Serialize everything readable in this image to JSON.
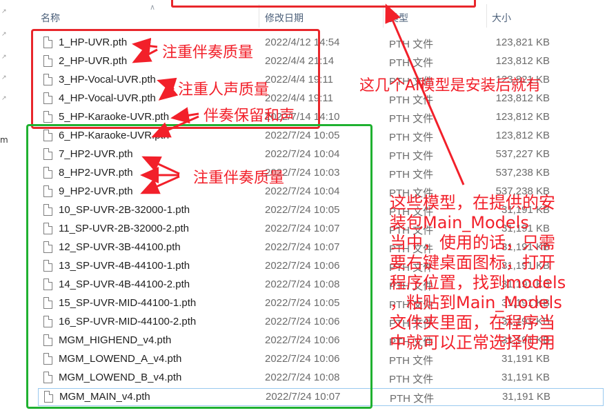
{
  "header": {
    "columns": [
      {
        "label": "名称"
      },
      {
        "label": "修改日期"
      },
      {
        "label": "类型"
      },
      {
        "label": "大小"
      }
    ]
  },
  "nav": {
    "partial_letter": "m"
  },
  "files": [
    {
      "name": "1_HP-UVR.pth",
      "date": "2022/4/12 14:54",
      "type": "PTH 文件",
      "size": "123,821 KB"
    },
    {
      "name": "2_HP-UVR.pth",
      "date": "2022/4/4 21:14",
      "type": "PTH 文件",
      "size": "123,812 KB"
    },
    {
      "name": "3_HP-Vocal-UVR.pth",
      "date": "2022/4/4 19:11",
      "type": "PTH 文件",
      "size": "123,821 KB"
    },
    {
      "name": "4_HP-Vocal-UVR.pth",
      "date": "2022/4/4 19:11",
      "type": "PTH 文件",
      "size": "123,812 KB"
    },
    {
      "name": "5_HP-Karaoke-UVR.pth",
      "date": "2022/7/14 14:10",
      "type": "PTH 文件",
      "size": "123,812 KB"
    },
    {
      "name": "6_HP-Karaoke-UVR.pth",
      "date": "2022/7/24 10:05",
      "type": "PTH 文件",
      "size": "123,812 KB"
    },
    {
      "name": "7_HP2-UVR.pth",
      "date": "2022/7/24 10:04",
      "type": "PTH 文件",
      "size": "537,227 KB"
    },
    {
      "name": "8_HP2-UVR.pth",
      "date": "2022/7/24 10:03",
      "type": "PTH 文件",
      "size": "537,238 KB"
    },
    {
      "name": "9_HP2-UVR.pth",
      "date": "2022/7/24 10:04",
      "type": "PTH 文件",
      "size": "537,238 KB"
    },
    {
      "name": "10_SP-UVR-2B-32000-1.pth",
      "date": "2022/7/24 10:05",
      "type": "PTH 文件",
      "size": "31,191 KB"
    },
    {
      "name": "11_SP-UVR-2B-32000-2.pth",
      "date": "2022/7/24 10:07",
      "type": "PTH 文件",
      "size": "31,191 KB"
    },
    {
      "name": "12_SP-UVR-3B-44100.pth",
      "date": "2022/7/24 10:07",
      "type": "PTH 文件",
      "size": "31,191 KB"
    },
    {
      "name": "13_SP-UVR-4B-44100-1.pth",
      "date": "2022/7/24 10:06",
      "type": "PTH 文件",
      "size": "31,191 KB"
    },
    {
      "name": "14_SP-UVR-4B-44100-2.pth",
      "date": "2022/7/24 10:08",
      "type": "PTH 文件",
      "size": "31,191 KB"
    },
    {
      "name": "15_SP-UVR-MID-44100-1.pth",
      "date": "2022/7/24 10:05",
      "type": "PTH 文件",
      "size": "31,191 KB"
    },
    {
      "name": "16_SP-UVR-MID-44100-2.pth",
      "date": "2022/7/24 10:06",
      "type": "PTH 文件",
      "size": "31,191 KB"
    },
    {
      "name": "MGM_HIGHEND_v4.pth",
      "date": "2022/7/24 10:06",
      "type": "PTH 文件",
      "size": "31,191 KB"
    },
    {
      "name": "MGM_LOWEND_A_v4.pth",
      "date": "2022/7/24 10:06",
      "type": "PTH 文件",
      "size": "31,191 KB"
    },
    {
      "name": "MGM_LOWEND_B_v4.pth",
      "date": "2022/7/24 10:08",
      "type": "PTH 文件",
      "size": "31,191 KB"
    },
    {
      "name": "MGM_MAIN_v4.pth",
      "date": "2022/7/24 10:07",
      "type": "PTH 文件",
      "size": "31,191 KB"
    }
  ],
  "annotations": {
    "accompaniment_quality_1": "注重伴奏质量",
    "vocal_quality": "注重人声质量",
    "keep_harmony": "伴奏保留和声",
    "accompaniment_quality_2": "注重伴奏质量",
    "preinstalled_note": "这几个AI模型是安装后就有",
    "main_models_note_lines": [
      "这些模型，在提供的安",
      "装包Main_Models",
      "当中，使用的话，只需",
      "要右键桌面图标，打开",
      "程序位置，找到models",
      "，粘贴到Main_Models",
      "文件夹里面，在程序当",
      "中就可以正常选择使用"
    ]
  },
  "colors": {
    "annotation_red": "#f2202a",
    "red_box": "#e8262b",
    "green_box": "#1fb130",
    "header_text": "#4c607a"
  }
}
